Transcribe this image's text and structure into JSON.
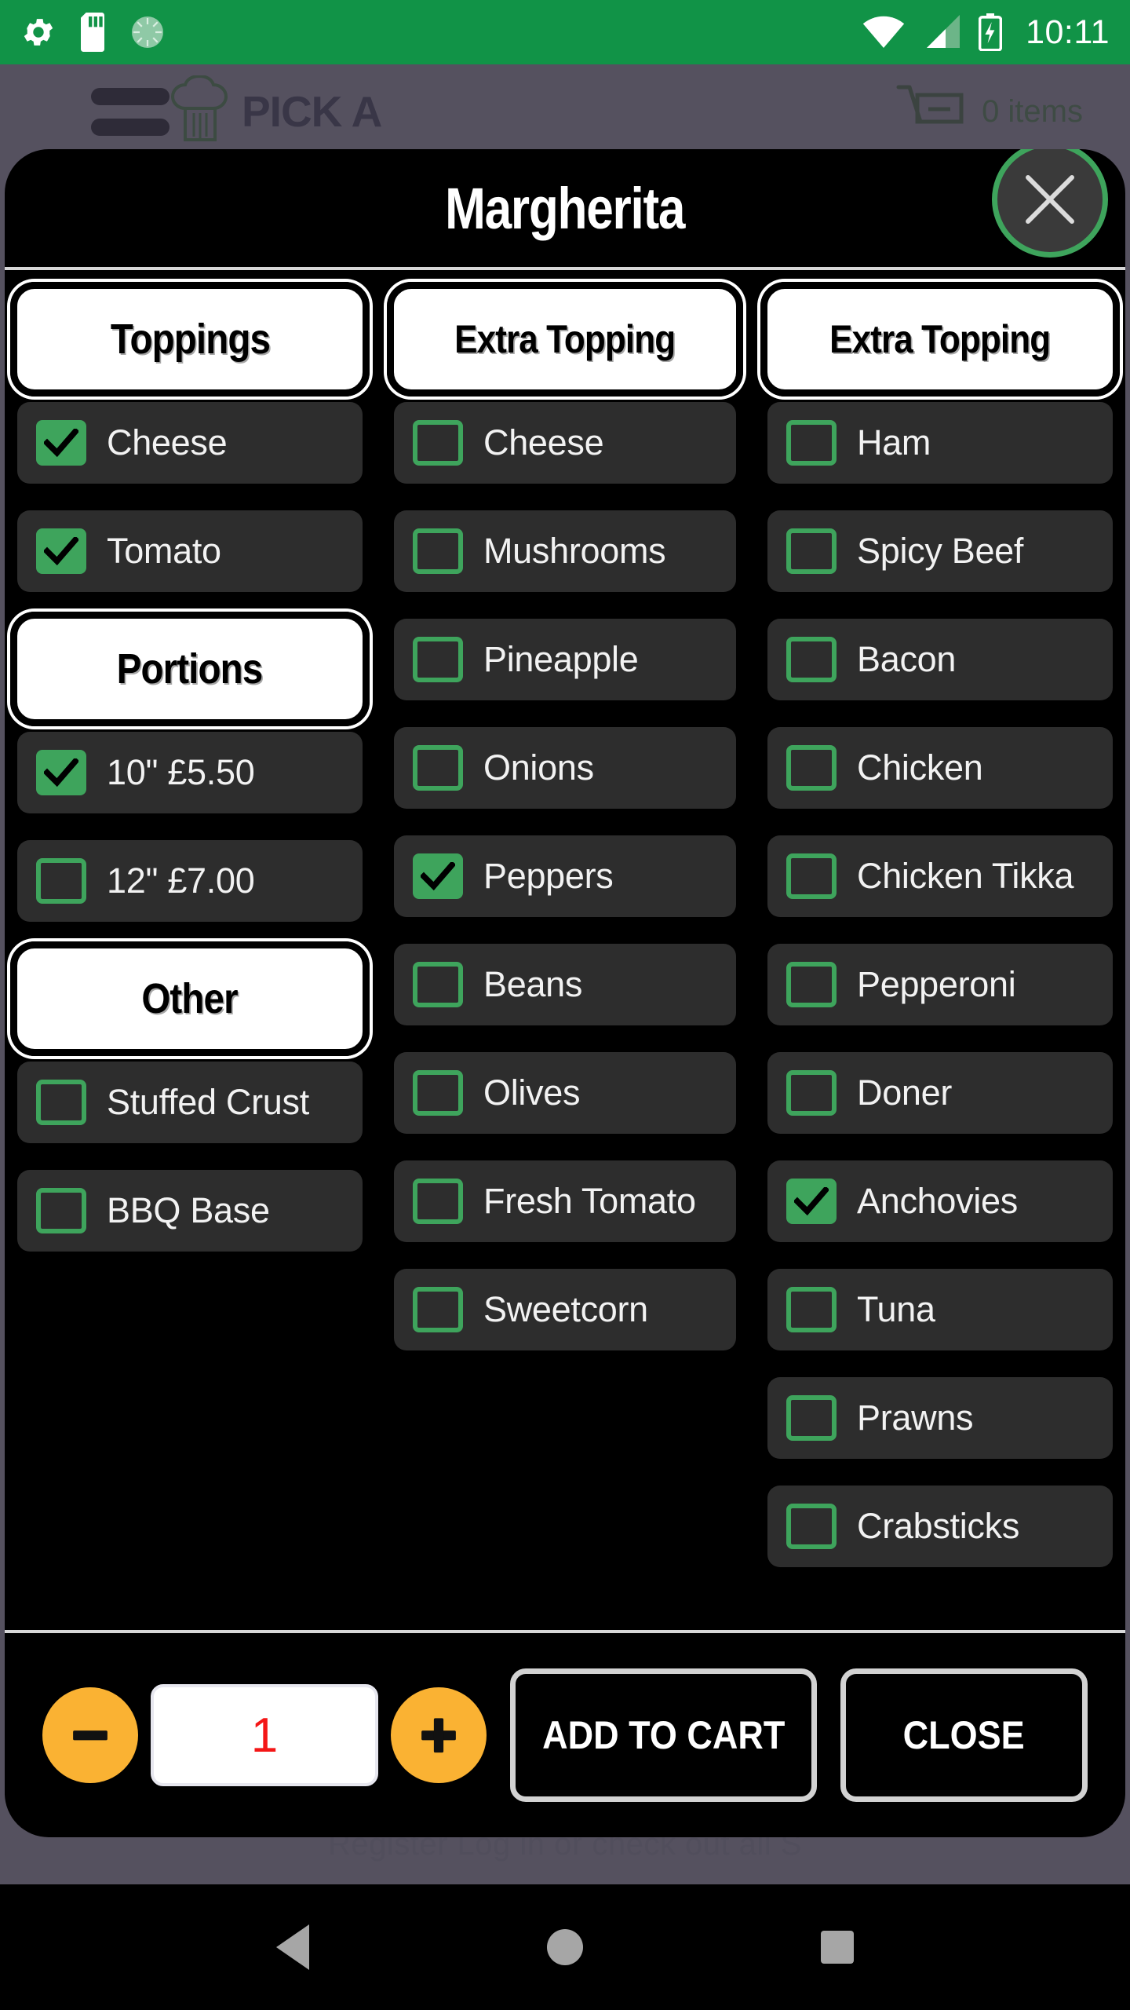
{
  "status_bar": {
    "time": "10:11",
    "icons": [
      "gear-icon",
      "sd-card-icon",
      "spinner-icon",
      "wifi-icon",
      "cellular-signal-icon",
      "battery-charging-icon"
    ]
  },
  "background_app": {
    "brand": "PICK A",
    "cart_label": "0 items",
    "footnote": "Register Log in or check out all S"
  },
  "modal": {
    "title": "Margherita",
    "close_icon_label": "close-icon"
  },
  "columns": [
    {
      "key": "left",
      "sections": [
        {
          "header": "Toppings",
          "options": [
            {
              "label": "Cheese",
              "checked": true
            },
            {
              "label": "Tomato",
              "checked": true
            }
          ]
        },
        {
          "header": "Portions",
          "options": [
            {
              "label": "10\" £5.50",
              "checked": true
            },
            {
              "label": "12\" £7.00",
              "checked": false
            }
          ]
        },
        {
          "header": "Other",
          "options": [
            {
              "label": "Stuffed Crust",
              "checked": false
            },
            {
              "label": "BBQ Base",
              "checked": false
            }
          ]
        }
      ]
    },
    {
      "key": "middle",
      "sections": [
        {
          "header": "Extra Topping",
          "options": [
            {
              "label": "Cheese",
              "checked": false
            },
            {
              "label": "Mushrooms",
              "checked": false
            },
            {
              "label": "Pineapple",
              "checked": false
            },
            {
              "label": "Onions",
              "checked": false
            },
            {
              "label": "Peppers",
              "checked": true
            },
            {
              "label": "Beans",
              "checked": false
            },
            {
              "label": "Olives",
              "checked": false
            },
            {
              "label": "Fresh Tomato",
              "checked": false
            },
            {
              "label": "Sweetcorn",
              "checked": false
            }
          ]
        }
      ]
    },
    {
      "key": "right",
      "sections": [
        {
          "header": "Extra Topping",
          "options": [
            {
              "label": "Ham",
              "checked": false
            },
            {
              "label": "Spicy Beef",
              "checked": false
            },
            {
              "label": "Bacon",
              "checked": false
            },
            {
              "label": "Chicken",
              "checked": false
            },
            {
              "label": "Chicken Tikka",
              "checked": false
            },
            {
              "label": "Pepperoni",
              "checked": false
            },
            {
              "label": "Doner",
              "checked": false
            },
            {
              "label": "Anchovies",
              "checked": true
            },
            {
              "label": "Tuna",
              "checked": false
            },
            {
              "label": "Prawns",
              "checked": false
            },
            {
              "label": "Crabsticks",
              "checked": false
            }
          ]
        }
      ]
    }
  ],
  "footer": {
    "decrement_icon": "minus-icon",
    "increment_icon": "plus-icon",
    "quantity": "1",
    "add_to_cart_label": "ADD TO CART",
    "close_label": "CLOSE"
  },
  "nav_bar": {
    "back_icon": "back-triangle-icon",
    "home_icon": "home-circle-icon",
    "recents_icon": "recents-square-icon"
  },
  "colors": {
    "status_bar_green": "#119347",
    "accent_green": "#3ea45c",
    "dim_backdrop": "#55515f",
    "row_bg": "#2d2d2d",
    "stepper_orange": "#fab233",
    "qty_red": "#f41616",
    "modal_bg": "#000000"
  }
}
